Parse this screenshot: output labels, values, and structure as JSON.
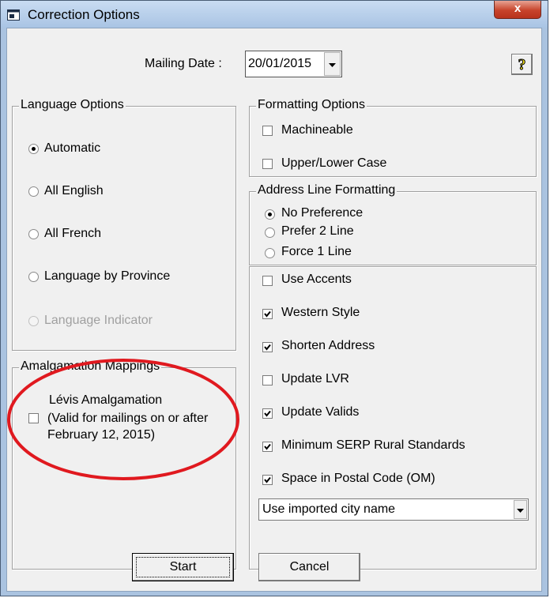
{
  "window": {
    "title": "Correction Options",
    "close_glyph": "x"
  },
  "mailing": {
    "label": "Mailing Date :",
    "value": "20/01/2015",
    "help_glyph": "?"
  },
  "language_options": {
    "legend": "Language Options",
    "options": [
      {
        "label": "Automatic",
        "selected": true,
        "enabled": true
      },
      {
        "label": "All English",
        "selected": false,
        "enabled": true
      },
      {
        "label": "All French",
        "selected": false,
        "enabled": true
      },
      {
        "label": "Language by Province",
        "selected": false,
        "enabled": true
      },
      {
        "label": "Language Indicator",
        "selected": false,
        "enabled": false
      }
    ]
  },
  "amalgamation": {
    "legend": "Amalgamation Mappings",
    "line1": "Lévis Amalgamation",
    "line2": "(Valid for mailings on or after",
    "line3": "February 12, 2015)",
    "checked": false
  },
  "formatting_options": {
    "legend": "Formatting Options",
    "items": [
      {
        "label": "Machineable",
        "checked": false
      },
      {
        "label": "Upper/Lower Case",
        "checked": false
      }
    ]
  },
  "address_line": {
    "legend": "Address Line Formatting",
    "options": [
      {
        "label": "No Preference",
        "selected": true
      },
      {
        "label": "Prefer 2 Line",
        "selected": false
      },
      {
        "label": "Force 1 Line",
        "selected": false
      }
    ]
  },
  "other_options": [
    {
      "label": "Use Accents",
      "checked": false
    },
    {
      "label": "Western Style",
      "checked": true
    },
    {
      "label": "Shorten Address",
      "checked": true
    },
    {
      "label": "Update LVR",
      "checked": false
    },
    {
      "label": "Update Valids",
      "checked": true
    },
    {
      "label": "Minimum SERP Rural Standards",
      "checked": true
    },
    {
      "label": "Space in Postal Code (OM)",
      "checked": true
    }
  ],
  "city_name": {
    "value": "Use imported city name"
  },
  "buttons": {
    "start": "Start",
    "cancel": "Cancel"
  },
  "colors": {
    "annotation_circle": "#e0191f",
    "title_gradient_top": "#c9dcf2",
    "close_button": "#c7432b"
  },
  "icons": {
    "title": "window-icon",
    "help": "question-mark-icon",
    "dropdown": "chevron-down-icon",
    "check": "checkmark-icon"
  }
}
